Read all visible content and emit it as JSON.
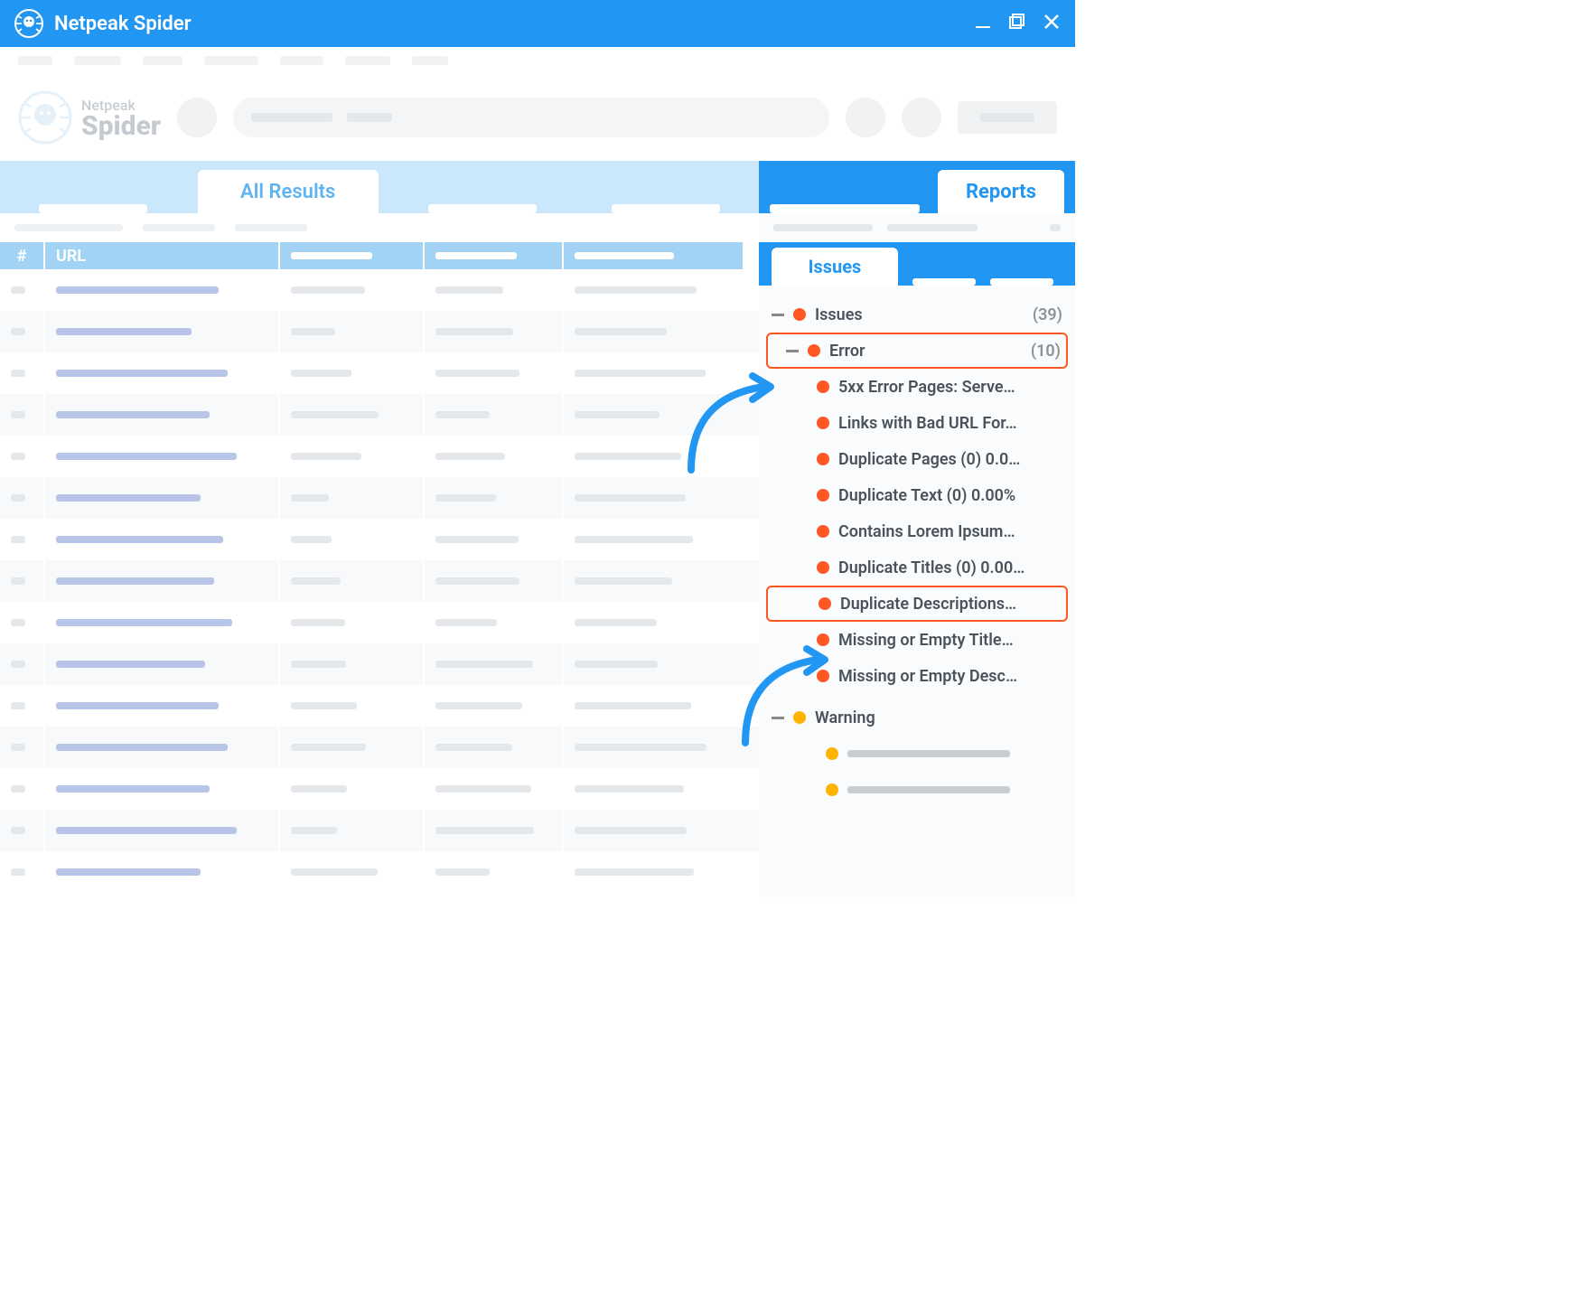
{
  "window": {
    "title": "Netpeak Spider"
  },
  "brand": {
    "line1": "Netpeak",
    "line2": "Spider"
  },
  "mainTabs": {
    "active": "All Results"
  },
  "table": {
    "idxHeader": "#",
    "urlHeader": "URL"
  },
  "side": {
    "reportsTab": "Reports",
    "issuesTab": "Issues",
    "root": {
      "label": "Issues",
      "count": "(39)"
    },
    "error": {
      "label": "Error",
      "count": "(10)"
    },
    "errors": [
      "5xx Error Pages: Serve…",
      "Links with Bad URL For…",
      "Duplicate Pages (0) 0.0…",
      "Duplicate Text (0) 0.00%",
      "Contains Lorem Ipsum…",
      "Duplicate Titles (0) 0.00…",
      "Duplicate Descriptions…",
      "Missing or Empty Title…",
      "Missing or Empty Desc…"
    ],
    "warning": {
      "label": "Warning"
    }
  }
}
